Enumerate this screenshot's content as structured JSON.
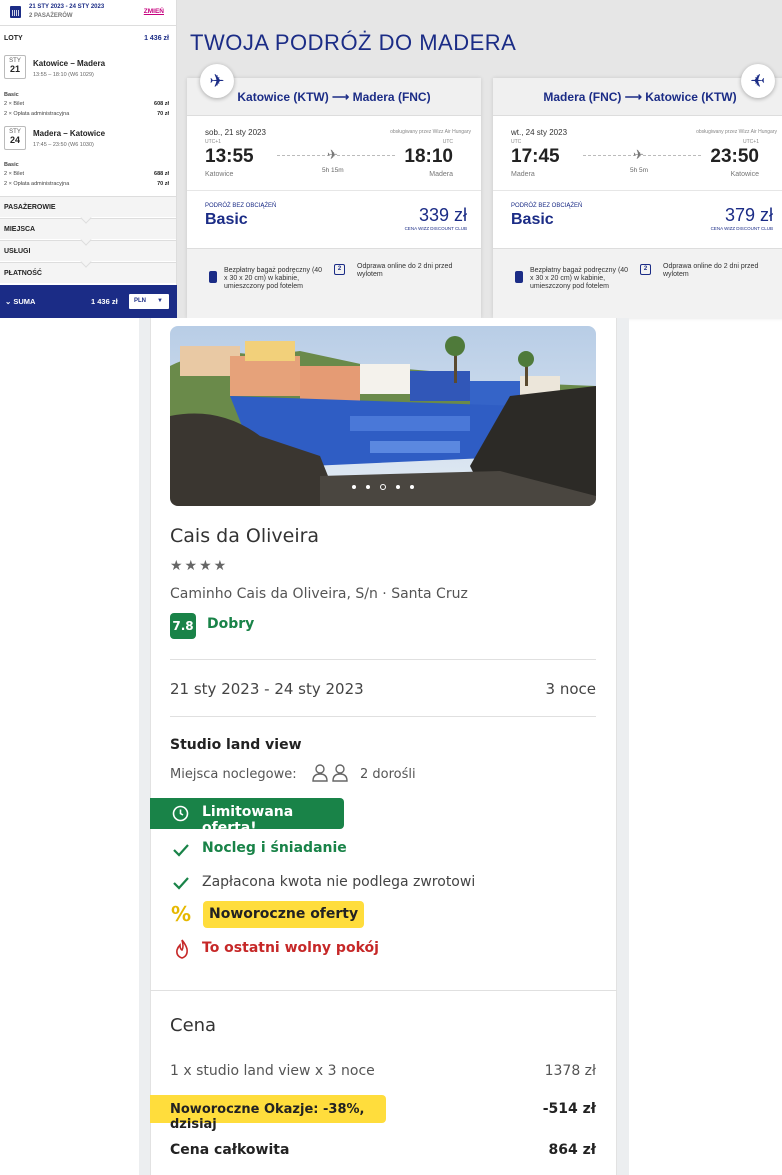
{
  "sidebar": {
    "dates": "21 STY 2023 - 24 STY 2023",
    "passengers": "2 PASAŻERÓW",
    "change": "ZMIEŃ",
    "flights_label": "LOTY",
    "flights_total": "1 436 zł",
    "leg1": {
      "month": "STY",
      "day": "21",
      "title": "Katowice – Madera",
      "sub": "13:55 – 18:10 (W6 1029)",
      "fare": "Basic",
      "ticket": "2 × Bilet",
      "ticket_price": "608 zł",
      "fee": "2 × Opłata administracyjna",
      "fee_price": "70 zł"
    },
    "leg2": {
      "month": "STY",
      "day": "24",
      "title": "Madera – Katowice",
      "sub": "17:45 – 23:50 (W6 1030)",
      "fare": "Basic",
      "ticket": "2 × Bilet",
      "ticket_price": "688 zł",
      "fee": "2 × Opłata administracyjna",
      "fee_price": "70 zł"
    },
    "sections": [
      "PASAŻEROWIE",
      "MIEJSCA",
      "USŁUGI",
      "PŁATNOŚĆ"
    ],
    "sum_label": "SUMA",
    "sum_value": "1 436 zł",
    "currency": "PLN"
  },
  "trip_title": "TWOJA PODRÓŻ DO MADERA",
  "outbound": {
    "route": "Katowice (KTW) ⟶ Madera (FNC)",
    "date": "sob., 21 sty 2023",
    "operator": "obsługiwany przez Wizz Air Hungary",
    "utc_dep": "UTC+1",
    "utc_arr": "UTC",
    "dep_time": "13:55",
    "arr_time": "18:10",
    "dep_city": "Katowice",
    "arr_city": "Madera",
    "duration": "5h 15m",
    "fare_label": "PODRÓŻ BEZ OBCIĄŻEŃ",
    "fare": "Basic",
    "price": "339 zł",
    "club": "CENA WIZZ DISCOUNT CLUB",
    "bag": "Bezpłatny bagaż podręczny (40 x 30 x 20 cm) w kabinie, umieszczony pod fotelem",
    "checkin": "Odprawa online do 2 dni przed wylotem",
    "checkin_icon": "2"
  },
  "inbound": {
    "route": "Madera (FNC) ⟶ Katowice (KTW)",
    "date": "wt., 24 sty 2023",
    "operator": "obsługiwany przez Wizz Air Hungary",
    "utc_dep": "UTC",
    "utc_arr": "UTC+1",
    "dep_time": "17:45",
    "arr_time": "23:50",
    "dep_city": "Madera",
    "arr_city": "Katowice",
    "duration": "5h 5m",
    "fare_label": "PODRÓŻ BEZ OBCIĄŻEŃ",
    "fare": "Basic",
    "price": "379 zł",
    "club": "CENA WIZZ DISCOUNT CLUB",
    "bag": "Bezpłatny bagaż podręczny (40 x 30 x 20 cm) w kabinie, umieszczony pod fotelem",
    "checkin": "Odprawa online do 2 dni przed wylotem",
    "checkin_icon": "2"
  },
  "hotel": {
    "name": "Cais da Oliveira",
    "stars": "★★★★",
    "address": "Caminho Cais da Oliveira, S/n · Santa Cruz",
    "score": "7.8",
    "score_label": "Dobry",
    "dates": "21 sty 2023 - 24 sty 2023",
    "nights": "3 noce",
    "room": "Studio land view",
    "occupancy_label": "Miejsca noclegowe:",
    "occupancy": "2 dorośli",
    "limited": "Limitowana oferta!",
    "feature1": "Nocleg i śniadanie",
    "feature2": "Zapłacona kwota nie podlega zwrotowi",
    "promo_badge": "Noworoczne oferty",
    "last_room": "To ostatni wolny pokój",
    "price_heading": "Cena",
    "line_desc": "1 x studio land view x 3 noce",
    "line_price": "1378 zł",
    "promo_desc": "Noworoczne Okazje: -38%, dzisiaj",
    "promo_price": "-514 zł",
    "total_label": "Cena całkowita",
    "total_price": "864 zł",
    "gallery_active": 3,
    "gallery_count": 5
  },
  "colors": {
    "wizz_navy": "#1b2c86",
    "wizz_magenta": "#c6007e",
    "green": "#198348",
    "yellow": "#ffdd3c",
    "red": "#c62828"
  }
}
